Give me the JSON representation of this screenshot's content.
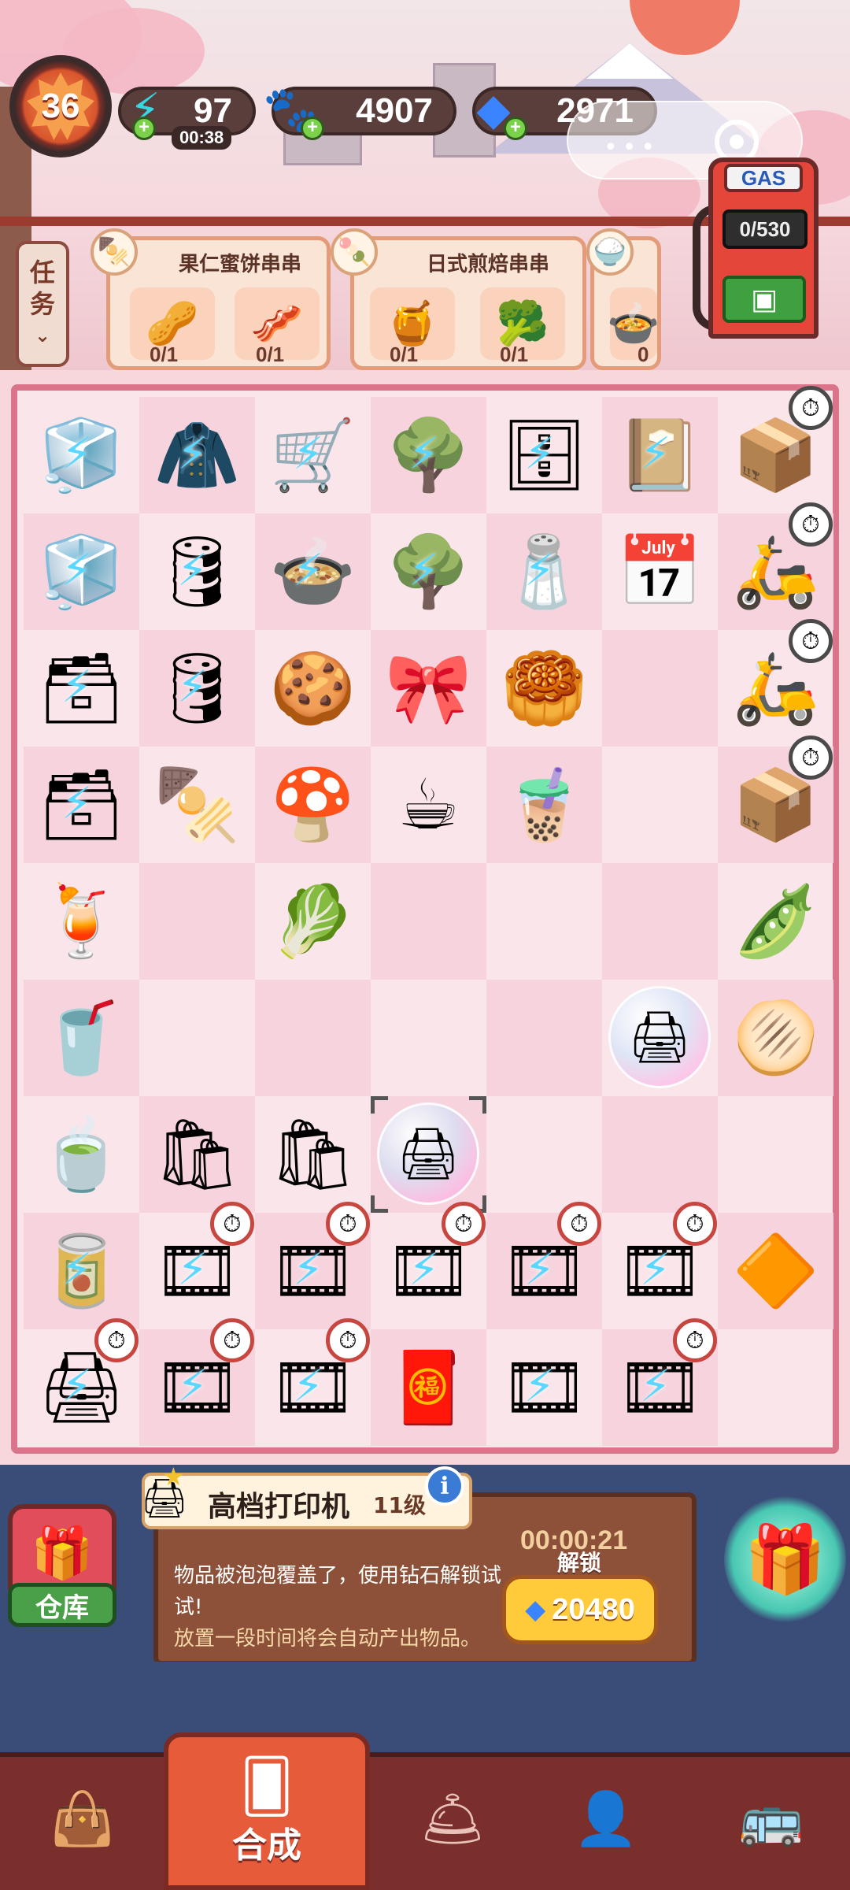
{
  "hud": {
    "level": "36",
    "energy": "97",
    "energy_timer": "00:38",
    "coins": "4907",
    "gems": "2971"
  },
  "gas_pump": {
    "label": "GAS",
    "capacity": "0/530"
  },
  "tasks_tab": {
    "label_line1": "任",
    "label_line2": "务"
  },
  "orders": [
    {
      "title": "果仁蜜饼串串",
      "icon": "skewer-plate-icon",
      "requirements": [
        {
          "icon": "nuts-pile-icon",
          "count": "0/1"
        },
        {
          "icon": "ham-slice-icon",
          "count": "0/1"
        }
      ]
    },
    {
      "title": "日式煎焙串串",
      "icon": "grilled-skewer-icon",
      "requirements": [
        {
          "icon": "jam-jar-icon",
          "count": "0/1"
        },
        {
          "icon": "broccoli-icon",
          "count": "0/1"
        }
      ]
    },
    {
      "title": "",
      "icon": "rice-bowl-icon",
      "requirements": [
        {
          "icon": "bowl-icon",
          "count": "0"
        }
      ]
    }
  ],
  "board": {
    "rows": [
      [
        "fridge-locked",
        "chef-jacket-locked",
        "skewer-cart-locked",
        "tree-branch-locked",
        "shelf-locked",
        "notebook-locked",
        "drone-package"
      ],
      [
        "fridge-locked",
        "barrel-locked",
        "skewer-pot-locked",
        "tree-branch-locked",
        "spice-rack-locked",
        "calendar",
        "delivery-scooter"
      ],
      [
        "safe-locked",
        "barrel-open-locked",
        "meatball",
        "candy-pouch",
        "seaweed-mat",
        "",
        "delivery-scooter"
      ],
      [
        "safe-locked",
        "meat-skewers",
        "shiitake-mushroom",
        "coffee-beans-sack",
        "bubble-tea",
        "",
        "hand-truck-boxes"
      ],
      [
        "strawberry-drink",
        "",
        "cabbage",
        "",
        "",
        "",
        "edamame-board"
      ],
      [
        "iced-cola",
        "",
        "",
        "",
        "",
        "printer-bubble",
        "scallion-bread"
      ],
      [
        "lemon-tea",
        "paper-bag",
        "paper-bag",
        "printer-bubble-selected",
        "",
        "",
        ""
      ],
      [
        "canned-drink-locked",
        "film-rolls-timer",
        "film-rolls-timer",
        "film-rolls-timer",
        "film-rolls-timer",
        "film-rolls-timer",
        "orange-gem"
      ],
      [
        "printer-timer",
        "film-rolls-timer",
        "film-rolls-timer",
        "red-envelope-box",
        "film-rolls-locked",
        "film-rolls-timer",
        ""
      ]
    ]
  },
  "info_panel": {
    "item_name": "高档打印机",
    "item_level": "11级",
    "description": "物品被泡泡覆盖了，使用钻石解锁试试!",
    "hint": "放置一段时间将会自动产出物品。",
    "countdown": "00:00:21",
    "unlock_label": "解锁",
    "unlock_cost": "20480",
    "storage_label": "仓库"
  },
  "nav": {
    "active_label": "合成",
    "items": [
      "shop-bag-icon",
      "merge-cards-icon",
      "service-bell-icon",
      "character-icon",
      "bus-icon"
    ]
  }
}
